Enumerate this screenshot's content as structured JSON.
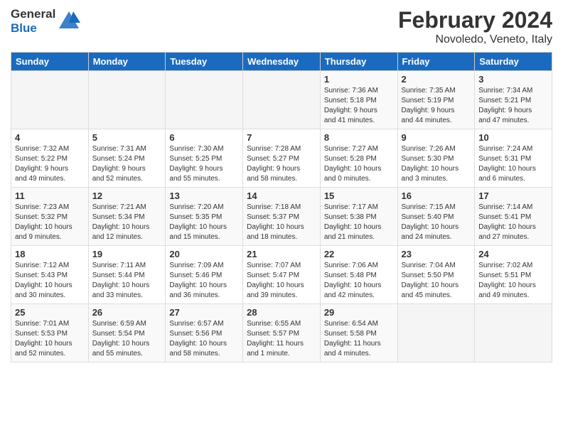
{
  "header": {
    "logo_line1": "General",
    "logo_line2": "Blue",
    "title": "February 2024",
    "subtitle": "Novoledo, Veneto, Italy"
  },
  "days_of_week": [
    "Sunday",
    "Monday",
    "Tuesday",
    "Wednesday",
    "Thursday",
    "Friday",
    "Saturday"
  ],
  "weeks": [
    [
      {
        "day": "",
        "info": ""
      },
      {
        "day": "",
        "info": ""
      },
      {
        "day": "",
        "info": ""
      },
      {
        "day": "",
        "info": ""
      },
      {
        "day": "1",
        "info": "Sunrise: 7:36 AM\nSunset: 5:18 PM\nDaylight: 9 hours\nand 41 minutes."
      },
      {
        "day": "2",
        "info": "Sunrise: 7:35 AM\nSunset: 5:19 PM\nDaylight: 9 hours\nand 44 minutes."
      },
      {
        "day": "3",
        "info": "Sunrise: 7:34 AM\nSunset: 5:21 PM\nDaylight: 9 hours\nand 47 minutes."
      }
    ],
    [
      {
        "day": "4",
        "info": "Sunrise: 7:32 AM\nSunset: 5:22 PM\nDaylight: 9 hours\nand 49 minutes."
      },
      {
        "day": "5",
        "info": "Sunrise: 7:31 AM\nSunset: 5:24 PM\nDaylight: 9 hours\nand 52 minutes."
      },
      {
        "day": "6",
        "info": "Sunrise: 7:30 AM\nSunset: 5:25 PM\nDaylight: 9 hours\nand 55 minutes."
      },
      {
        "day": "7",
        "info": "Sunrise: 7:28 AM\nSunset: 5:27 PM\nDaylight: 9 hours\nand 58 minutes."
      },
      {
        "day": "8",
        "info": "Sunrise: 7:27 AM\nSunset: 5:28 PM\nDaylight: 10 hours\nand 0 minutes."
      },
      {
        "day": "9",
        "info": "Sunrise: 7:26 AM\nSunset: 5:30 PM\nDaylight: 10 hours\nand 3 minutes."
      },
      {
        "day": "10",
        "info": "Sunrise: 7:24 AM\nSunset: 5:31 PM\nDaylight: 10 hours\nand 6 minutes."
      }
    ],
    [
      {
        "day": "11",
        "info": "Sunrise: 7:23 AM\nSunset: 5:32 PM\nDaylight: 10 hours\nand 9 minutes."
      },
      {
        "day": "12",
        "info": "Sunrise: 7:21 AM\nSunset: 5:34 PM\nDaylight: 10 hours\nand 12 minutes."
      },
      {
        "day": "13",
        "info": "Sunrise: 7:20 AM\nSunset: 5:35 PM\nDaylight: 10 hours\nand 15 minutes."
      },
      {
        "day": "14",
        "info": "Sunrise: 7:18 AM\nSunset: 5:37 PM\nDaylight: 10 hours\nand 18 minutes."
      },
      {
        "day": "15",
        "info": "Sunrise: 7:17 AM\nSunset: 5:38 PM\nDaylight: 10 hours\nand 21 minutes."
      },
      {
        "day": "16",
        "info": "Sunrise: 7:15 AM\nSunset: 5:40 PM\nDaylight: 10 hours\nand 24 minutes."
      },
      {
        "day": "17",
        "info": "Sunrise: 7:14 AM\nSunset: 5:41 PM\nDaylight: 10 hours\nand 27 minutes."
      }
    ],
    [
      {
        "day": "18",
        "info": "Sunrise: 7:12 AM\nSunset: 5:43 PM\nDaylight: 10 hours\nand 30 minutes."
      },
      {
        "day": "19",
        "info": "Sunrise: 7:11 AM\nSunset: 5:44 PM\nDaylight: 10 hours\nand 33 minutes."
      },
      {
        "day": "20",
        "info": "Sunrise: 7:09 AM\nSunset: 5:46 PM\nDaylight: 10 hours\nand 36 minutes."
      },
      {
        "day": "21",
        "info": "Sunrise: 7:07 AM\nSunset: 5:47 PM\nDaylight: 10 hours\nand 39 minutes."
      },
      {
        "day": "22",
        "info": "Sunrise: 7:06 AM\nSunset: 5:48 PM\nDaylight: 10 hours\nand 42 minutes."
      },
      {
        "day": "23",
        "info": "Sunrise: 7:04 AM\nSunset: 5:50 PM\nDaylight: 10 hours\nand 45 minutes."
      },
      {
        "day": "24",
        "info": "Sunrise: 7:02 AM\nSunset: 5:51 PM\nDaylight: 10 hours\nand 49 minutes."
      }
    ],
    [
      {
        "day": "25",
        "info": "Sunrise: 7:01 AM\nSunset: 5:53 PM\nDaylight: 10 hours\nand 52 minutes."
      },
      {
        "day": "26",
        "info": "Sunrise: 6:59 AM\nSunset: 5:54 PM\nDaylight: 10 hours\nand 55 minutes."
      },
      {
        "day": "27",
        "info": "Sunrise: 6:57 AM\nSunset: 5:56 PM\nDaylight: 10 hours\nand 58 minutes."
      },
      {
        "day": "28",
        "info": "Sunrise: 6:55 AM\nSunset: 5:57 PM\nDaylight: 11 hours\nand 1 minute."
      },
      {
        "day": "29",
        "info": "Sunrise: 6:54 AM\nSunset: 5:58 PM\nDaylight: 11 hours\nand 4 minutes."
      },
      {
        "day": "",
        "info": ""
      },
      {
        "day": "",
        "info": ""
      }
    ]
  ]
}
